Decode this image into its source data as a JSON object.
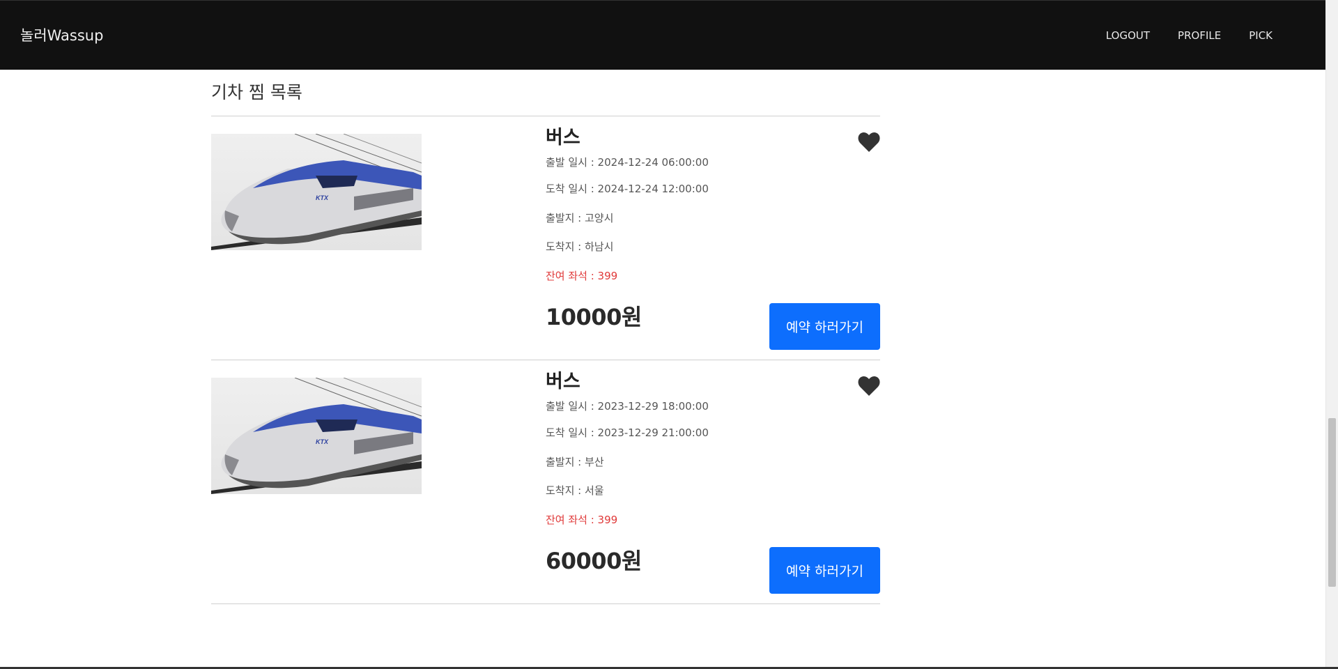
{
  "header": {
    "brand": "놀러Wassup",
    "nav": [
      "LOGOUT",
      "PROFILE",
      "PICK"
    ]
  },
  "page": {
    "title": "기차 찜 목록"
  },
  "items": [
    {
      "title": "버스",
      "departure_time": "출발 일시 : 2024-12-24 06:00:00",
      "arrival_time": "도착 일시 : 2024-12-24 12:00:00",
      "origin": "출발지 : 고양시",
      "destination": "도착지 : 하남시",
      "seats": "잔여 좌석 : 399",
      "price": "10000원",
      "button": "예약 하러가기",
      "image_label": "KTX"
    },
    {
      "title": "버스",
      "departure_time": "출발 일시 : 2023-12-29 18:00:00",
      "arrival_time": "도착 일시 : 2023-12-29 21:00:00",
      "origin": "출발지 : 부산",
      "destination": "도착지 : 서울",
      "seats": "잔여 좌석 : 399",
      "price": "60000원",
      "button": "예약 하러가기",
      "image_label": "KTX"
    }
  ],
  "colors": {
    "header_bg": "#111111",
    "button_bg": "#0d6efd",
    "seats_text": "#e03a3a",
    "heart": "#333333"
  },
  "icons": {
    "favorite": "heart-icon"
  }
}
